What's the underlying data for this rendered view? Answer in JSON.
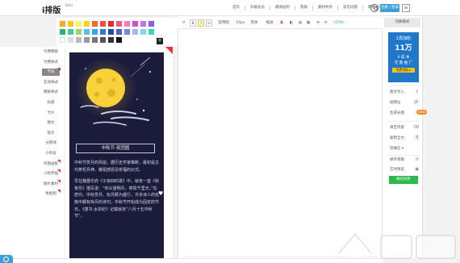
{
  "header": {
    "logo": "i排版",
    "logo_tag": "Beta",
    "nav": [
      "首页",
      "升级会员",
      "邀请返利",
      "帮助",
      "素材共享",
      "常见问题",
      "模板分享"
    ],
    "login_label": "注册 | 登录",
    "more_label": "≡"
  },
  "palette": {
    "row1": [
      "#f5a623",
      "#f8c71c",
      "#fff25a",
      "#ffd11b",
      "#f26a2a",
      "#ff4b3a",
      "#e32a2a",
      "#f25779",
      "#f57bbd",
      "#d84ac6",
      "#c773e4",
      "#8c5ee6"
    ],
    "row2": [
      "#22b573",
      "#4fc3a0",
      "#9cd36f",
      "#4fc6e2",
      "#3aa6e8",
      "#2f79d6",
      "#1d4fa8",
      "#4b63c9",
      "#7c83e0",
      "#a7b6f5",
      "#80d6f0",
      "#3fd1c8"
    ],
    "row3": [
      "#ffffff",
      "#dddddd",
      "#bbbbbb",
      "#999999",
      "#777777",
      "#555555",
      "#333333",
      "#111111"
    ],
    "add_label": "+"
  },
  "left_menu": [
    {
      "label": "付费模板",
      "active": false,
      "flag": false
    },
    {
      "label": "付费样式",
      "active": false,
      "flag": false
    },
    {
      "label": "节日",
      "active": true,
      "flag": true
    },
    {
      "label": "互动样式",
      "active": false,
      "flag": false
    },
    {
      "label": "模板样式",
      "active": false,
      "flag": false
    },
    {
      "label": "标题",
      "active": false,
      "flag": false
    },
    {
      "label": "卡片",
      "active": false,
      "flag": false
    },
    {
      "label": "图文",
      "active": false,
      "flag": false
    },
    {
      "label": "提示",
      "active": false,
      "flag": false
    },
    {
      "label": "分割线",
      "active": false,
      "flag": false
    },
    {
      "label": "小符号",
      "active": false,
      "flag": false
    },
    {
      "label": "作图画板",
      "active": false,
      "flag": true
    },
    {
      "label": "小程序插",
      "active": false,
      "flag": true
    },
    {
      "label": "图片素材",
      "active": false,
      "flag": true
    },
    {
      "label": "免抠图",
      "active": false,
      "flag": true
    }
  ],
  "preview": {
    "title": "中秋节·夜团圆",
    "paragraphs": [
      "中秋节赏月的风俗，据历史学家推断，最初是古代祭祀月神、娥祖感恩及祈福的仪式。",
      "早在魏晋乐府《子夜四时歌》中，就有一首《秋夜月》描写道：“仰头望明月，寄情千里光。”在唐代，中秋赏月、玩月颇为盛行，许多诗人的名篇中都有咏月的诗句，中秋节开始成为固定的节日。《唐书·太宗纪》记载就有“八月十五中秋节”。"
    ]
  },
  "toolbar": {
    "items": [
      "✐",
      "B",
      "I",
      "U",
      "常用图",
      "16px",
      "黑体",
      "缩进",
      "A",
      "◧",
      "▤",
      "▦",
      "⟲",
      "⟳",
      "HTML"
    ]
  },
  "right_panel": {
    "title": "切换模式",
    "ad": {
      "line1": "1周加粉",
      "line2": "11万",
      "line3": "0 成 本",
      "line4": "无 需 推 广",
      "button": "免费领取 ▸"
    },
    "buttons": [
      {
        "label": "图文导入",
        "icon": "↥"
      },
      {
        "label": "短网址",
        "icon": "🔗"
      },
      {
        "label": "生成长图",
        "icon": "⬚"
      },
      {
        "label": "清空内容",
        "icon": "⌫"
      },
      {
        "label": "复制全文",
        "icon": "⎘"
      },
      {
        "label": "到微信 ▾",
        "icon": ""
      },
      {
        "label": "保存草稿",
        "icon": "⟳"
      },
      {
        "label": "实时预览",
        "icon": "▣"
      }
    ],
    "new_badge": "NEW",
    "green_button": "微信同步"
  },
  "colors": {
    "accent": "#3a9fd8",
    "flag": "#e33333",
    "ad_blue": "#1f78c9",
    "green": "#2db84d",
    "preview_bg": "#1b1b3c",
    "moon": "#f9d13a"
  }
}
